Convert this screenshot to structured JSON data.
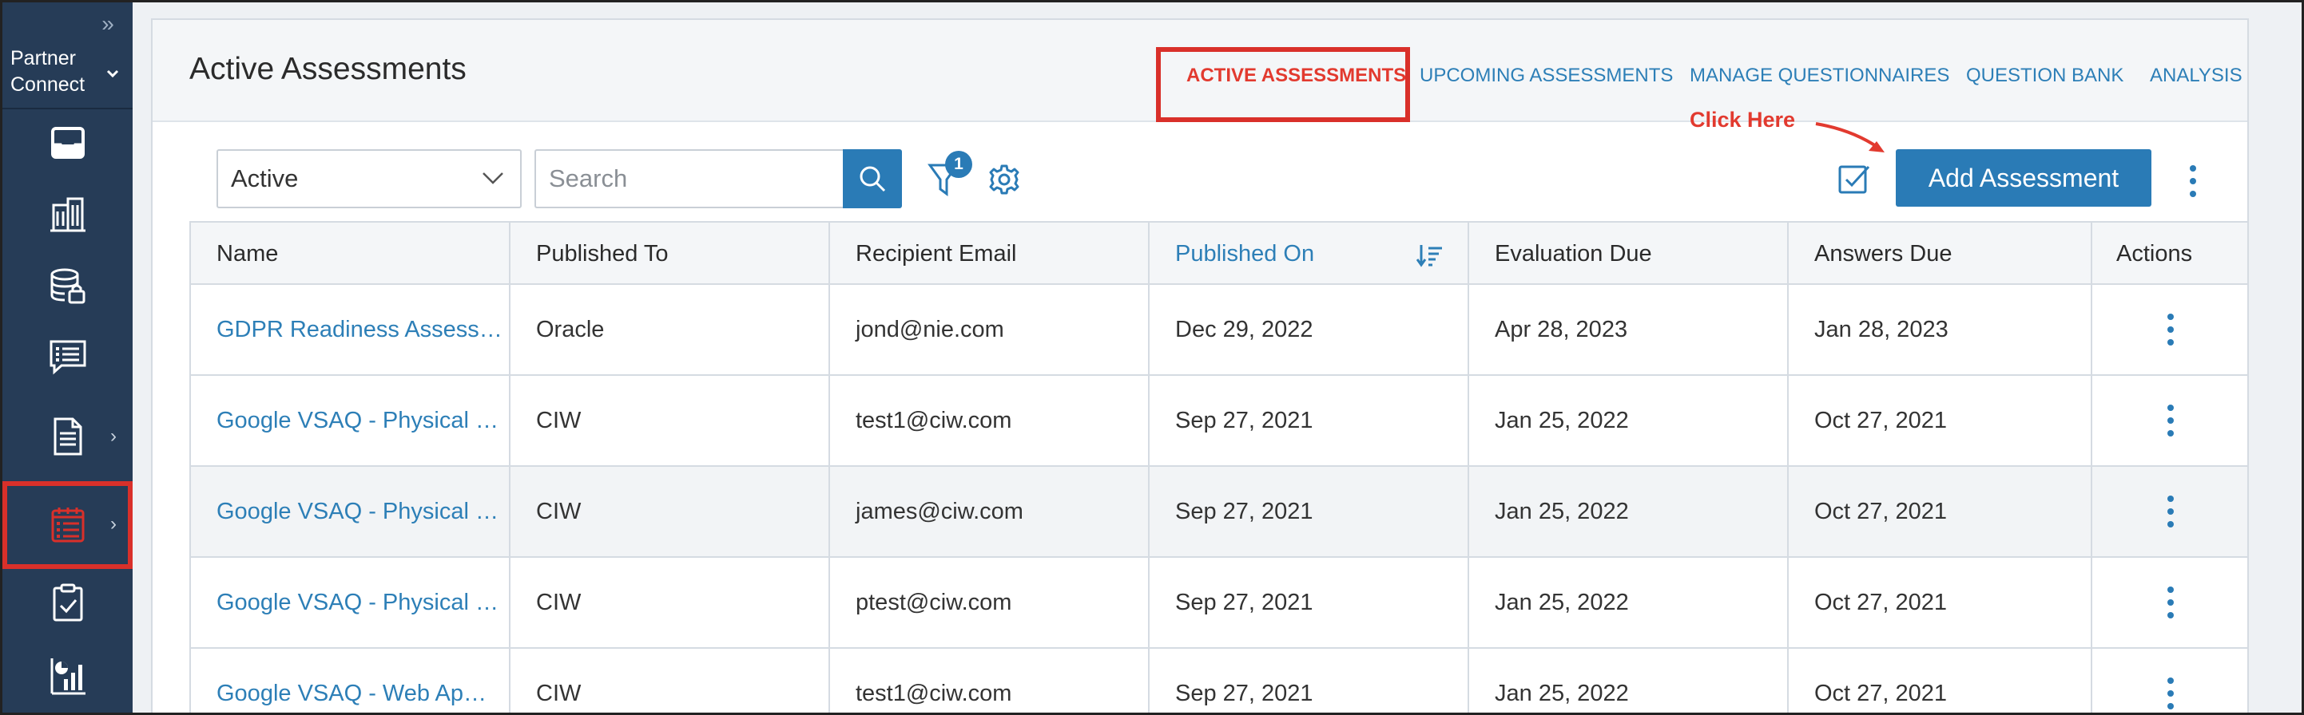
{
  "sidebar": {
    "brand_line1": "Partner",
    "brand_line2": "Connect",
    "items": [
      {
        "icon": "inbox-icon"
      },
      {
        "icon": "buildings-icon"
      },
      {
        "icon": "database-lock-icon"
      },
      {
        "icon": "checklist-icon"
      },
      {
        "icon": "document-icon",
        "has_submenu": true
      },
      {
        "icon": "calendar-list-icon",
        "has_submenu": true,
        "active": true
      },
      {
        "icon": "clipboard-check-icon"
      },
      {
        "icon": "bar-chart-icon"
      }
    ]
  },
  "header": {
    "title": "Active Assessments",
    "tabs": [
      {
        "label": "ACTIVE ASSESSMENTS",
        "active": true
      },
      {
        "label": "UPCOMING ASSESSMENTS"
      },
      {
        "label": "MANAGE QUESTIONNAIRES"
      },
      {
        "label": "QUESTION BANK"
      },
      {
        "label": "ANALYSIS"
      }
    ]
  },
  "toolbar": {
    "status_value": "Active",
    "search_placeholder": "Search",
    "filter_count": "1",
    "add_label": "Add Assessment",
    "annotation": "Click Here"
  },
  "table": {
    "columns": [
      "Name",
      "Published To",
      "Recipient Email",
      "Published On",
      "Evaluation Due",
      "Answers Due",
      "Actions"
    ],
    "sorted_column": "Published On",
    "rows": [
      {
        "name": "GDPR Readiness Assess…",
        "published_to": "Oracle",
        "email": "jond@nie.com",
        "published_on": "Dec 29, 2022",
        "evaluation_due": "Apr 28, 2023",
        "answers_due": "Jan 28, 2023"
      },
      {
        "name": "Google VSAQ - Physical …",
        "published_to": "CIW",
        "email": "test1@ciw.com",
        "published_on": "Sep 27, 2021",
        "evaluation_due": "Jan 25, 2022",
        "answers_due": "Oct 27, 2021"
      },
      {
        "name": "Google VSAQ - Physical …",
        "published_to": "CIW",
        "email": "james@ciw.com",
        "published_on": "Sep 27, 2021",
        "evaluation_due": "Jan 25, 2022",
        "answers_due": "Oct 27, 2021"
      },
      {
        "name": "Google VSAQ - Physical …",
        "published_to": "CIW",
        "email": "ptest@ciw.com",
        "published_on": "Sep 27, 2021",
        "evaluation_due": "Jan 25, 2022",
        "answers_due": "Oct 27, 2021"
      },
      {
        "name": "Google VSAQ - Web Ap…",
        "published_to": "CIW",
        "email": "test1@ciw.com",
        "published_on": "Sep 27, 2021",
        "evaluation_due": "Jan 25, 2022",
        "answers_due": "Oct 27, 2021"
      }
    ]
  },
  "colors": {
    "sidebar_bg": "#263c57",
    "accent": "#2a7bb6",
    "highlight_red": "#d9302a",
    "link": "#2d7fb7"
  }
}
